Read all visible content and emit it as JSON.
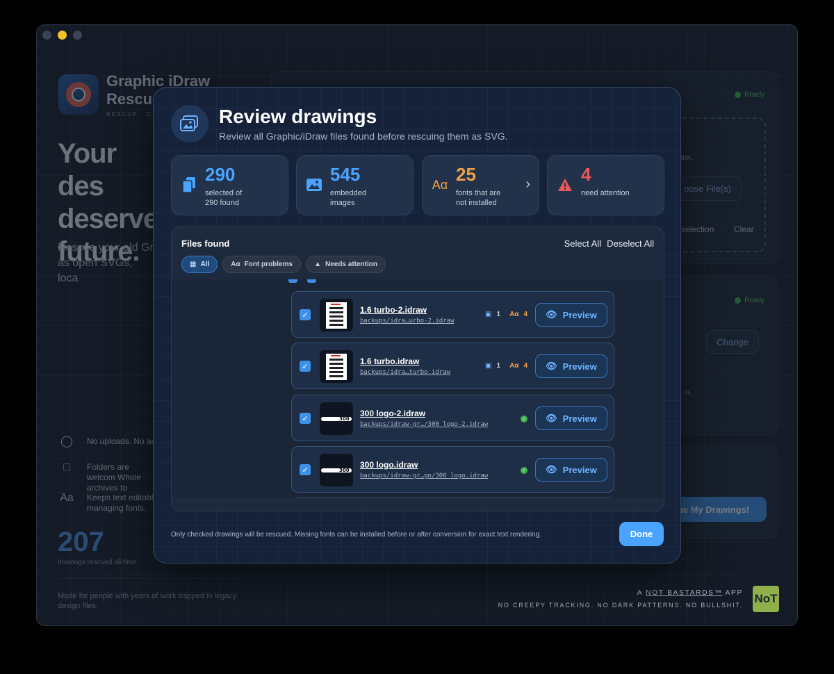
{
  "window": {
    "app_name": "Graphic iDraw Rescue",
    "app_subtitle": "RESCUE · CON",
    "hero": "Your des deserve future.",
    "hero_sub": "Rescue your old Gr as open SVGs, loca",
    "features": [
      {
        "icon": "shield-lock-icon",
        "text": "No uploads. No ac"
      },
      {
        "icon": "folder-icon",
        "text": "Folders are welcom Whole archives to"
      },
      {
        "icon": "font-aa-icon",
        "text": "Keeps text editabl managing fonts."
      }
    ],
    "counter": "207",
    "counter_label": "drawings rescued all-time",
    "made_for": "Made for people with years of work trapped in legacy design files.",
    "panel1": {
      "status": "Ready",
      "hint": "ater.",
      "choose": "oose File(s)",
      "view_selection": "w selection",
      "clear": "Clear"
    },
    "panel2": {
      "status": "Ready",
      "change": "Change",
      "note": "n."
    },
    "rescue_button": "ue My Drawings!",
    "footer_brand_prefix": "A ",
    "footer_brand_link": "NOT BASTARDS™",
    "footer_brand_suffix": " APP",
    "footer_tagline": "NO CREEPY TRACKING. NO DARK PATTERNS. NO BULLSHIT.",
    "logo_text": "NoT"
  },
  "modal": {
    "title": "Review drawings",
    "subtitle": "Review all Graphic/iDraw files found before rescuing them as SVG.",
    "stats": [
      {
        "icon": "files-icon",
        "value": "290",
        "label": "selected of 290 found",
        "color": "#4aa3ff"
      },
      {
        "icon": "image-icon",
        "value": "545",
        "label": "embedded images",
        "color": "#4aa3ff"
      },
      {
        "icon": "font-aa-icon",
        "value": "25",
        "label": "fonts that are not installed",
        "color": "#f0a04a"
      },
      {
        "icon": "warning-icon",
        "value": "4",
        "label": "need attention",
        "color": "#e85a5a"
      }
    ],
    "files_header": "Files found",
    "select_all": "Select All",
    "deselect_all": "Deselect All",
    "filters": [
      {
        "icon": "grid-icon",
        "label": "All",
        "active": true
      },
      {
        "icon": "font-aa-icon",
        "label": "Font problems",
        "active": false
      },
      {
        "icon": "warning-icon",
        "label": "Needs attention",
        "active": false
      }
    ],
    "rows": [
      {
        "name": "1.6 turbo-2.idraw",
        "path": "backups/idra…urbo-2.idraw",
        "images": "1",
        "fonts": "4",
        "ok": false
      },
      {
        "name": "1.6 turbo.idraw",
        "path": "backups/idra…turbo.idraw",
        "images": "1",
        "fonts": "4",
        "ok": false
      },
      {
        "name": "300 logo-2.idraw",
        "path": "backups/idraw-gr…/300 logo-2.idraw",
        "ok": true
      },
      {
        "name": "300 logo.idraw",
        "path": "backups/idraw-gr…gn/300 logo.idraw",
        "ok": true
      }
    ],
    "preview_label": "Preview",
    "footer_note": "Only checked drawings will be rescued. Missing fonts can be installed before or after conversion for exact text rendering.",
    "done": "Done"
  }
}
